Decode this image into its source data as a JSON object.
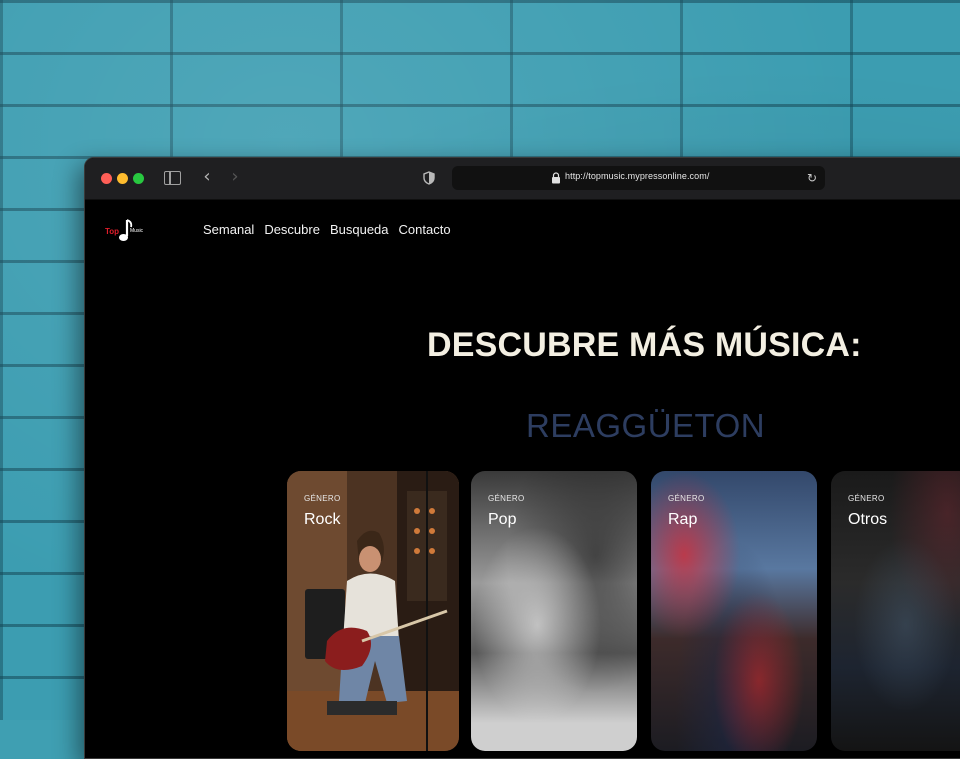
{
  "browser": {
    "url": "http://topmusic.mypressonline.com/"
  },
  "site": {
    "logo_text": "Top",
    "logo_subtext": "Music",
    "nav": [
      "Semanal",
      "Descubre",
      "Busqueda",
      "Contacto"
    ]
  },
  "hero": {
    "headline": "DESCUBRE MÁS MÚSICA:",
    "rotating_word": "REAGGÜETON"
  },
  "cards": [
    {
      "small": "GÉNERO",
      "title": "Rock"
    },
    {
      "small": "GÉNERO",
      "title": "Pop"
    },
    {
      "small": "GÉNERO",
      "title": "Rap"
    },
    {
      "small": "GÉNERO",
      "title": "Otros"
    }
  ],
  "colors": {
    "wall": "#3c9db1",
    "page_bg": "#000000",
    "headline": "#f3efe2",
    "rotating_word": "#2d3d60",
    "logo_red": "#e11d2a"
  }
}
